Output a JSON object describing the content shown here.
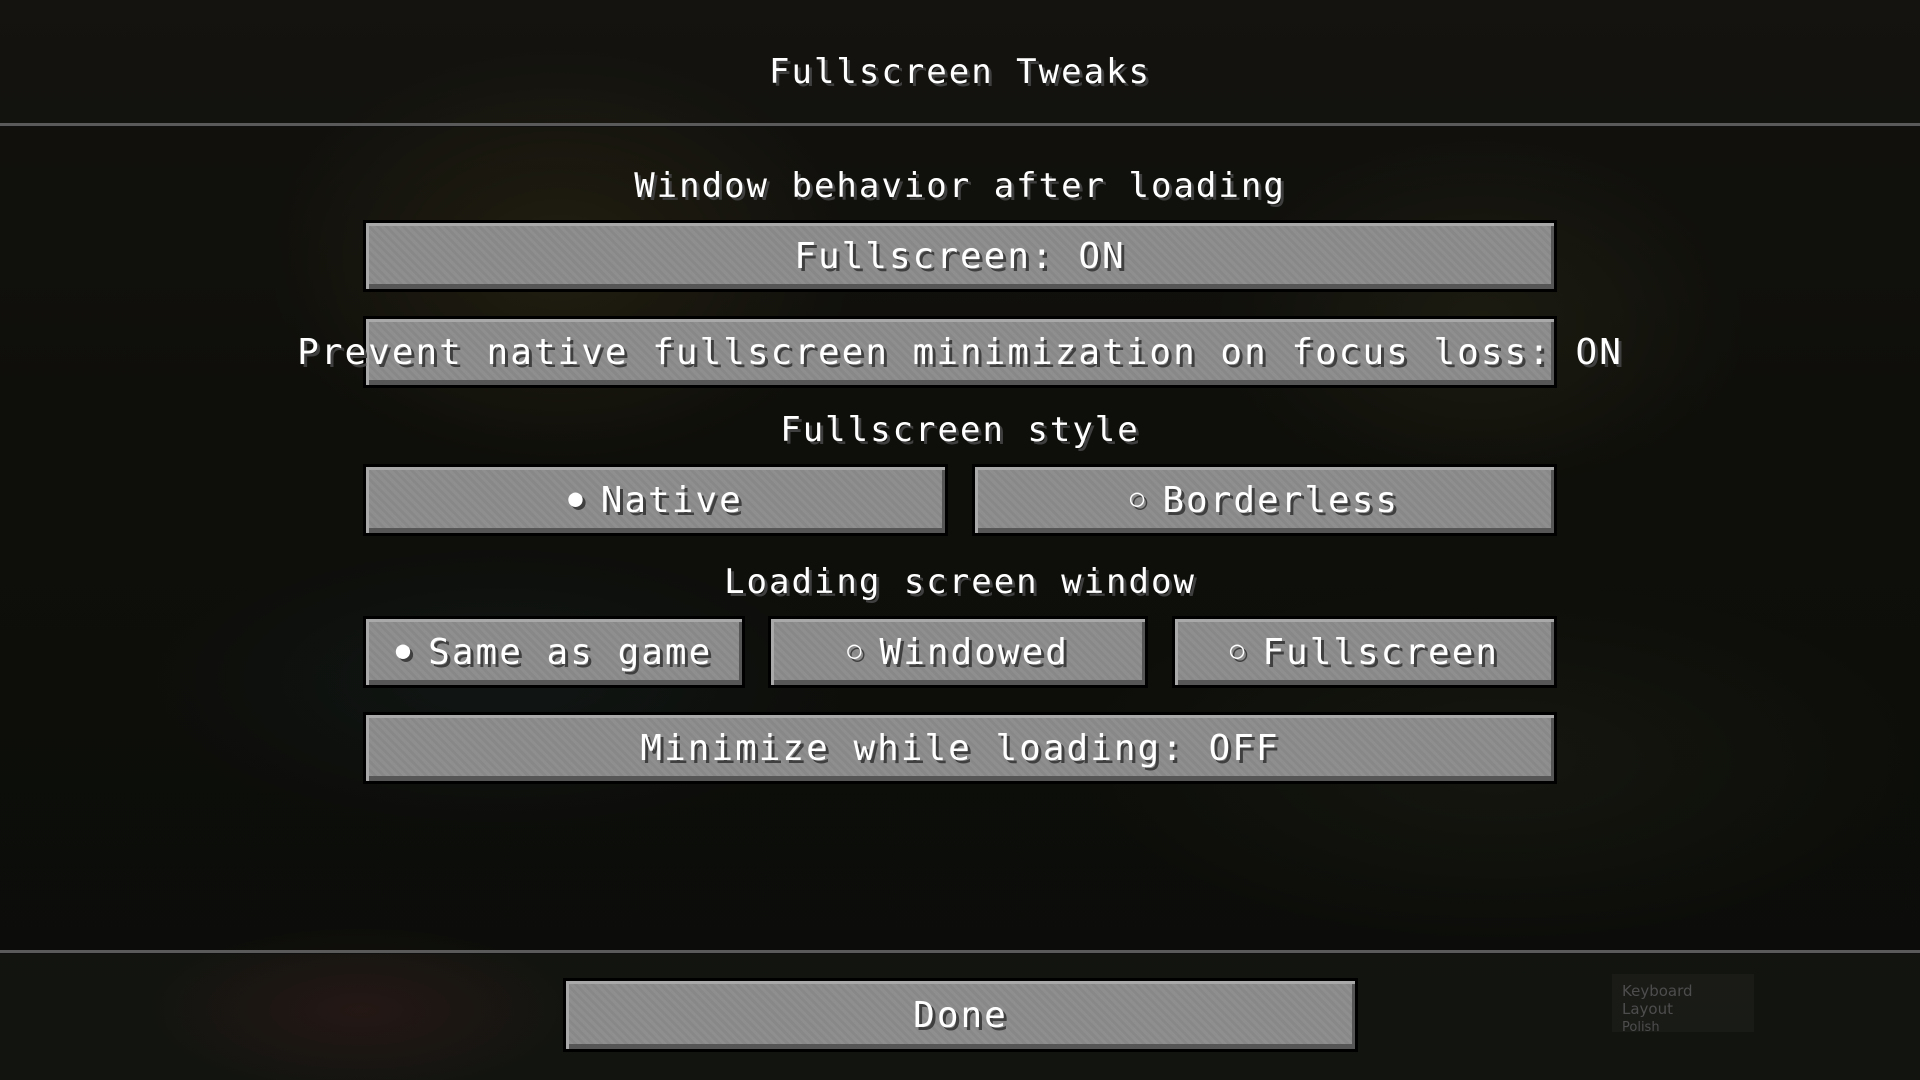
{
  "screen": {
    "title": "Fullscreen Tweaks"
  },
  "sections": {
    "window_behavior": "Window behavior after loading",
    "fullscreen_style": "Fullscreen style",
    "loading_screen_window": "Loading screen window"
  },
  "buttons": {
    "fullscreen": "Fullscreen: ON",
    "prevent_minimization": "Prevent native fullscreen minimization on focus loss: ON",
    "minimize_while_loading": "Minimize while loading: OFF",
    "done": "Done"
  },
  "fullscreen_style_options": [
    {
      "label": "Native",
      "selected": true,
      "icon": "filled-radio-icon",
      "glyph": "●"
    },
    {
      "label": "Borderless",
      "selected": false,
      "icon": "empty-radio-icon",
      "glyph": "○"
    }
  ],
  "loading_window_options": [
    {
      "label": "Same as game",
      "selected": true,
      "icon": "filled-radio-icon",
      "glyph": "●"
    },
    {
      "label": "Windowed",
      "selected": false,
      "icon": "empty-radio-icon",
      "glyph": "○"
    },
    {
      "label": "Fullscreen",
      "selected": false,
      "icon": "empty-radio-icon",
      "glyph": "○"
    }
  ],
  "keyboard_overlay": {
    "title": "Keyboard Layout",
    "value": "Polish"
  },
  "colors": {
    "button_face": "#8c8c8c",
    "text": "#ffffff",
    "text_shadow": "#3f3f3f"
  }
}
